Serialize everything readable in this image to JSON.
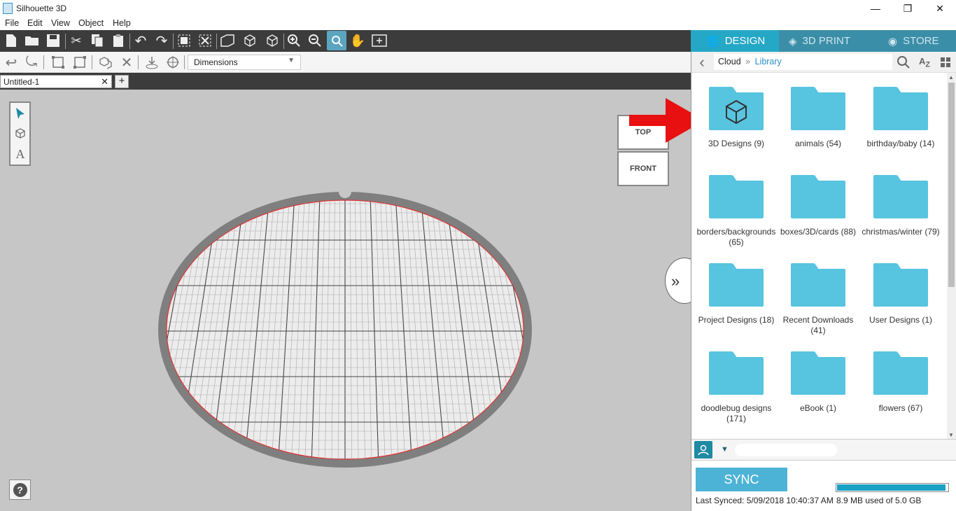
{
  "window": {
    "title": "Silhouette 3D"
  },
  "menu": [
    "File",
    "Edit",
    "View",
    "Object",
    "Help"
  ],
  "toolbar2": {
    "dimensions_select": "Dimensions"
  },
  "document_tab": {
    "name": "Untitled-1"
  },
  "view_cube": {
    "top": "TOP",
    "front": "FRONT"
  },
  "panel": {
    "tabs": {
      "design": "DESIGN",
      "print": "3D PRINT",
      "store": "STORE"
    },
    "breadcrumb": {
      "root": "Cloud",
      "sep": "»",
      "current": "Library"
    },
    "folders": [
      {
        "label": "3D Designs (9)",
        "has_cube": true
      },
      {
        "label": "animals (54)"
      },
      {
        "label": "birthday/baby (14)"
      },
      {
        "label": "borders/backgrounds (65)"
      },
      {
        "label": "boxes/3D/cards (88)"
      },
      {
        "label": "christmas/winter (79)"
      },
      {
        "label": "Project Designs (18)"
      },
      {
        "label": "Recent Downloads (41)"
      },
      {
        "label": "User Designs (1)"
      },
      {
        "label": "doodlebug designs (171)"
      },
      {
        "label": "eBook (1)"
      },
      {
        "label": "flowers (67)"
      }
    ],
    "sync": {
      "button": "SYNC",
      "last_synced": "Last Synced: 5/09/2018 10:40:37 AM",
      "storage_text": "8.9 MB used of 5.0 GB",
      "storage_fraction": 0.98
    }
  },
  "colors": {
    "accent": "#25a7c6",
    "folder": "#57c4e0",
    "arrow": "#e81010"
  }
}
